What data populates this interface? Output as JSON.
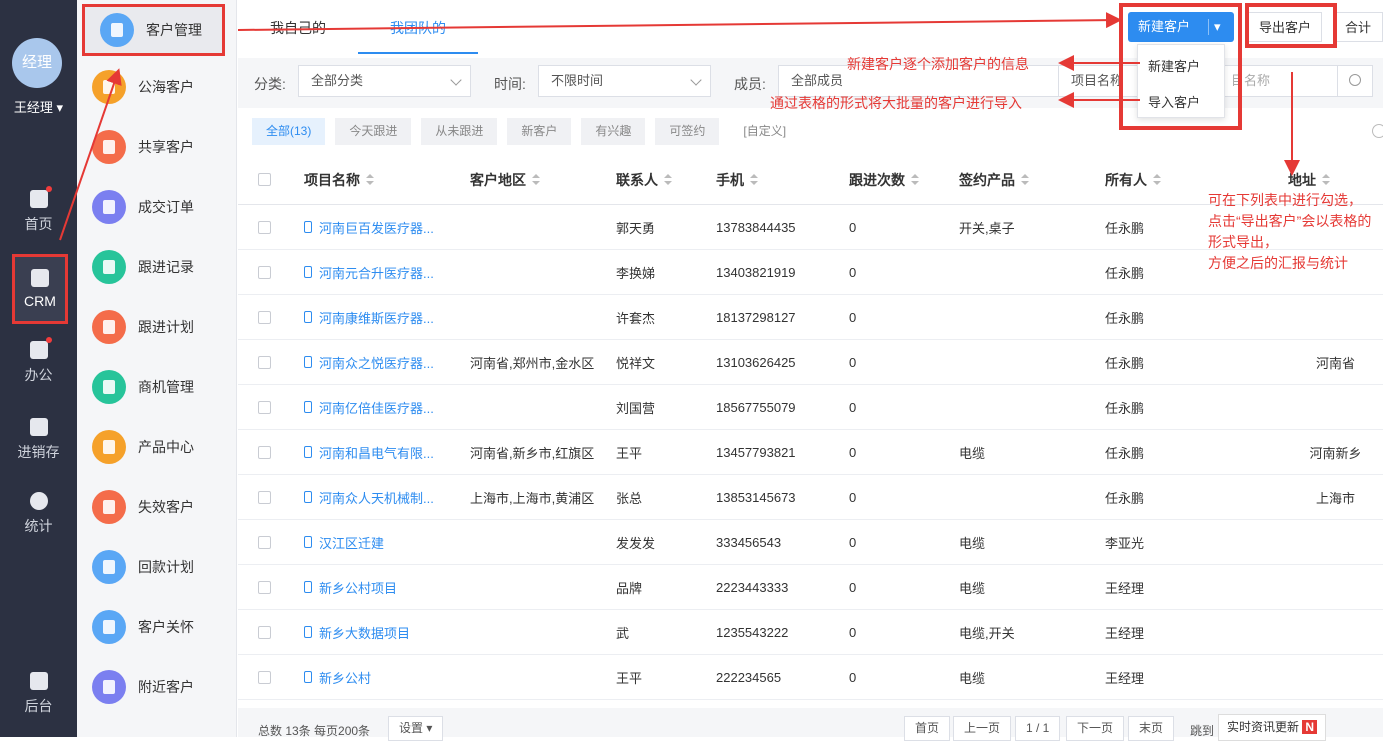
{
  "rail": {
    "avatar": "经理",
    "user": "王经理",
    "items": [
      {
        "label": "首页",
        "icon": "home-icon"
      },
      {
        "label": "CRM",
        "icon": "crm-icon"
      },
      {
        "label": "办公",
        "icon": "briefcase-icon"
      },
      {
        "label": "进销存",
        "icon": "inventory-icon"
      },
      {
        "label": "统计",
        "icon": "pie-chart-icon"
      },
      {
        "label": "后台",
        "icon": "apps-icon"
      }
    ]
  },
  "menu": [
    {
      "label": "客户管理",
      "color": "#5aa7f5"
    },
    {
      "label": "公海客户",
      "color": "#f5a12a"
    },
    {
      "label": "共享客户",
      "color": "#f46c4a"
    },
    {
      "label": "成交订单",
      "color": "#7b7ff0"
    },
    {
      "label": "跟进记录",
      "color": "#27c49a"
    },
    {
      "label": "跟进计划",
      "color": "#f46c4a"
    },
    {
      "label": "商机管理",
      "color": "#27c49a"
    },
    {
      "label": "产品中心",
      "color": "#f5a12a"
    },
    {
      "label": "失效客户",
      "color": "#f46c4a"
    },
    {
      "label": "回款计划",
      "color": "#5aa7f5"
    },
    {
      "label": "客户关怀",
      "color": "#5aa7f5"
    },
    {
      "label": "附近客户",
      "color": "#7b7ff0"
    }
  ],
  "tabs": {
    "mine": "我自己的",
    "team": "我团队的"
  },
  "toolbar": {
    "new": "新建客户",
    "export": "导出客户",
    "total": "合计"
  },
  "dropdown": {
    "item1": "新建客户",
    "item2": "导入客户"
  },
  "filters": {
    "category_label": "分类:",
    "category_value": "全部分类",
    "time_label": "时间:",
    "time_value": "不限时间",
    "member_label": "成员:",
    "member_value": "全部成员",
    "search_field": "项目名称",
    "search_placeholder": "目名称"
  },
  "chips": [
    "全部(13)",
    "今天跟进",
    "从未跟进",
    "新客户",
    "有兴趣",
    "可签约",
    "[自定义]"
  ],
  "columns": [
    "项目名称",
    "客户地区",
    "联系人",
    "手机",
    "跟进次数",
    "签约产品",
    "所有人",
    "地址"
  ],
  "rows": [
    [
      "河南巨百发医疗器...",
      "",
      "郭天勇",
      "13783844435",
      "0",
      "开关,桌子",
      "任永鹏",
      ""
    ],
    [
      "河南元合升医疗器...",
      "",
      "李换娣",
      "13403821919",
      "0",
      "",
      "任永鹏",
      ""
    ],
    [
      "河南康维斯医疗器...",
      "",
      "许套杰",
      "18137298127",
      "0",
      "",
      "任永鹏",
      ""
    ],
    [
      "河南众之悦医疗器...",
      "河南省,郑州市,金水区",
      "悦祥文",
      "13103626425",
      "0",
      "",
      "任永鹏",
      "河南省"
    ],
    [
      "河南亿倍佳医疗器...",
      "",
      "刘国营",
      "18567755079",
      "0",
      "",
      "任永鹏",
      ""
    ],
    [
      "河南和昌电气有限...",
      "河南省,新乡市,红旗区",
      "王平",
      "13457793821",
      "0",
      "电缆",
      "任永鹏",
      "河南新乡"
    ],
    [
      "河南众人天机械制...",
      "上海市,上海市,黄浦区",
      "张总",
      "13853145673",
      "0",
      "",
      "任永鹏",
      "上海市"
    ],
    [
      "汉江区迁建",
      "",
      "发发发",
      "333456543",
      "0",
      "电缆",
      "李亚光",
      ""
    ],
    [
      "新乡公村项目",
      "",
      "品牌",
      "2223443333",
      "0",
      "电缆",
      "王经理",
      ""
    ],
    [
      "新乡大数据项目",
      "",
      "武",
      "1235543222",
      "0",
      "电缆,开关",
      "王经理",
      ""
    ],
    [
      "新乡公村",
      "",
      "王平",
      "222234565",
      "0",
      "电缆",
      "王经理",
      ""
    ]
  ],
  "footer": {
    "summary": "总数 13条 每页200条",
    "settings": "设置",
    "first": "首页",
    "prev": "上一页",
    "page": "1 / 1",
    "next": "下一页",
    "last": "末页",
    "jump": "跳到",
    "news": "实时资讯更新",
    "news_badge": "N"
  },
  "annotations": {
    "new_note": "新建客户逐个添加客户的信息",
    "import_note": "通过表格的形式将大批量的客户进行导入",
    "export_note": "可在下列表中进行勾选，\n点击“导出客户”会以表格的形式导出，\n方便之后的汇报与统计"
  }
}
